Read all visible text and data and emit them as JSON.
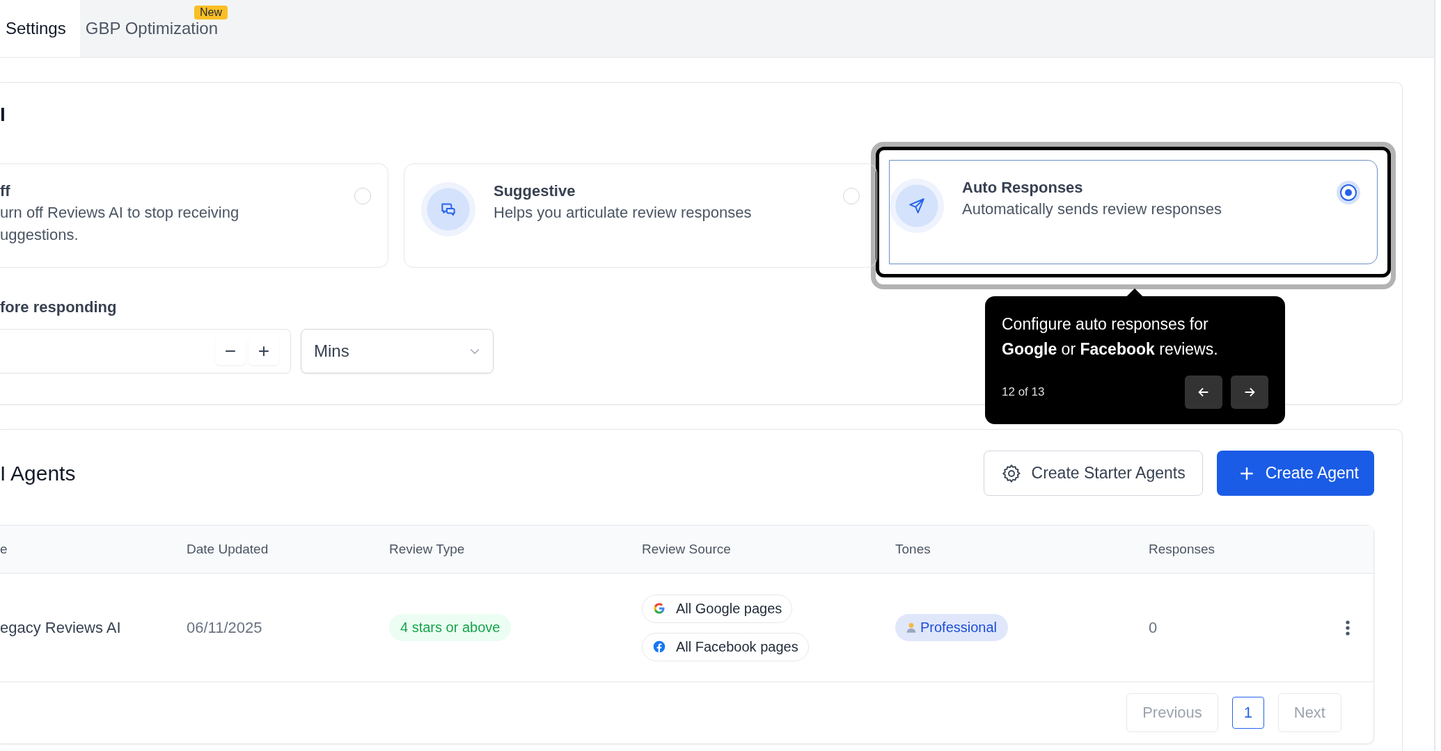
{
  "tabs": [
    {
      "label": "Settings",
      "selected": true
    },
    {
      "label": "GBP Optimization",
      "selected": false,
      "badge": "New"
    }
  ],
  "reviews_ai": {
    "title": "I",
    "modes": [
      {
        "kind": "plain",
        "title": "ff",
        "description_lines": [
          "urn off Reviews AI to stop receiving",
          "uggestions."
        ],
        "selected": false
      },
      {
        "kind": "chat",
        "title": "Suggestive",
        "description_lines": [
          "Helps you articulate review responses"
        ],
        "selected": false
      },
      {
        "kind": "send",
        "title": "Auto Responses",
        "description_lines": [
          "Automatically sends review responses"
        ],
        "selected": true
      }
    ],
    "delay": {
      "label": "fore responding",
      "decrement": "−",
      "increment": "+",
      "unit": "Mins"
    }
  },
  "tour_tooltip": {
    "text": "Configure auto responses for **Google** or **Facebook** reviews.",
    "step": "12 of 13"
  },
  "agents": {
    "title": "I Agents",
    "buttons": [
      {
        "kind": "secondary",
        "label": "Create Starter Agents"
      },
      {
        "kind": "primary",
        "label": "Create Agent"
      }
    ],
    "table": {
      "columns": [
        "e",
        "Date Updated",
        "Review Type",
        "Review Source",
        "Tones",
        "Responses"
      ],
      "rows": [
        {
          "name": "egacy Reviews AI",
          "date_updated": "06/11/2025",
          "review_type": "4 stars or above",
          "review_sources": [
            {
              "kind": "google",
              "label": "All Google pages"
            },
            {
              "kind": "facebook",
              "label": "All Facebook pages"
            }
          ],
          "tones": [
            "Professional"
          ],
          "responses": "0"
        }
      ]
    },
    "pagination": {
      "previous": {
        "label": "Previous",
        "disabled": true
      },
      "pages": [
        {
          "label": "1",
          "selected": true
        }
      ],
      "next": {
        "label": "Next",
        "disabled": true
      }
    }
  }
}
